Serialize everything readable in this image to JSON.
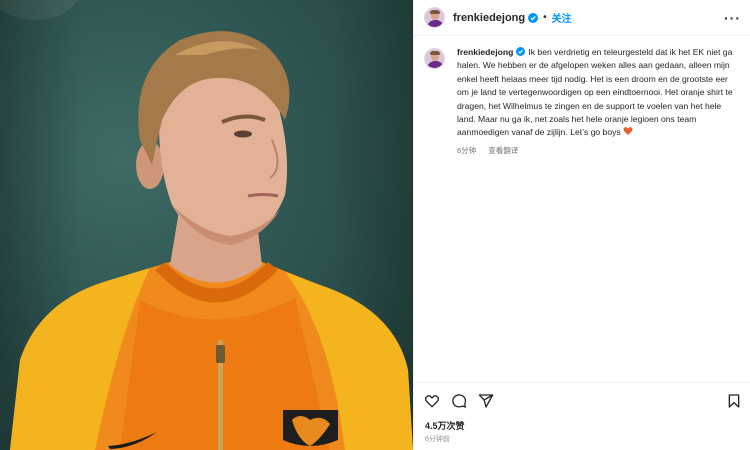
{
  "post": {
    "username": "frenkiedejong",
    "follow_label": "关注",
    "separator": "•",
    "more_icon": "more-icon",
    "caption_text": "Ik ben verdrietig en teleurgesteld dat ik het EK niet ga halen. We hebben er de afgelopen weken alles aan gedaan, alleen mijn enkel heeft helaas meer tijd nodig. Het is een droom en de grootste eer om je land te vertegenwoordigen op een eindtoernooi. Het oranje shirt te dragen, het Wilhelmus te zingen en de support te voelen van het hele land. Maar nu ga ik, net zoals het hele oranje legioen ons team aanmoedigen vanaf de zijlijn. Let’s go boys",
    "caption_age": "6分钟",
    "translate_label": "查看翻译",
    "likes": "4.5万次赞",
    "timestamp": "6分钟前"
  },
  "colors": {
    "accent": "#0095f6",
    "verified": "#0095f6",
    "heart_emoji": "#e8612c",
    "text": "#262626",
    "muted": "#737373",
    "jersey_orange": "#f08a1c",
    "jersey_yellow": "#f4b41e"
  },
  "icons": [
    "like-icon",
    "comment-icon",
    "share-icon",
    "save-icon",
    "verified-badge-icon",
    "orange-heart-emoji"
  ]
}
